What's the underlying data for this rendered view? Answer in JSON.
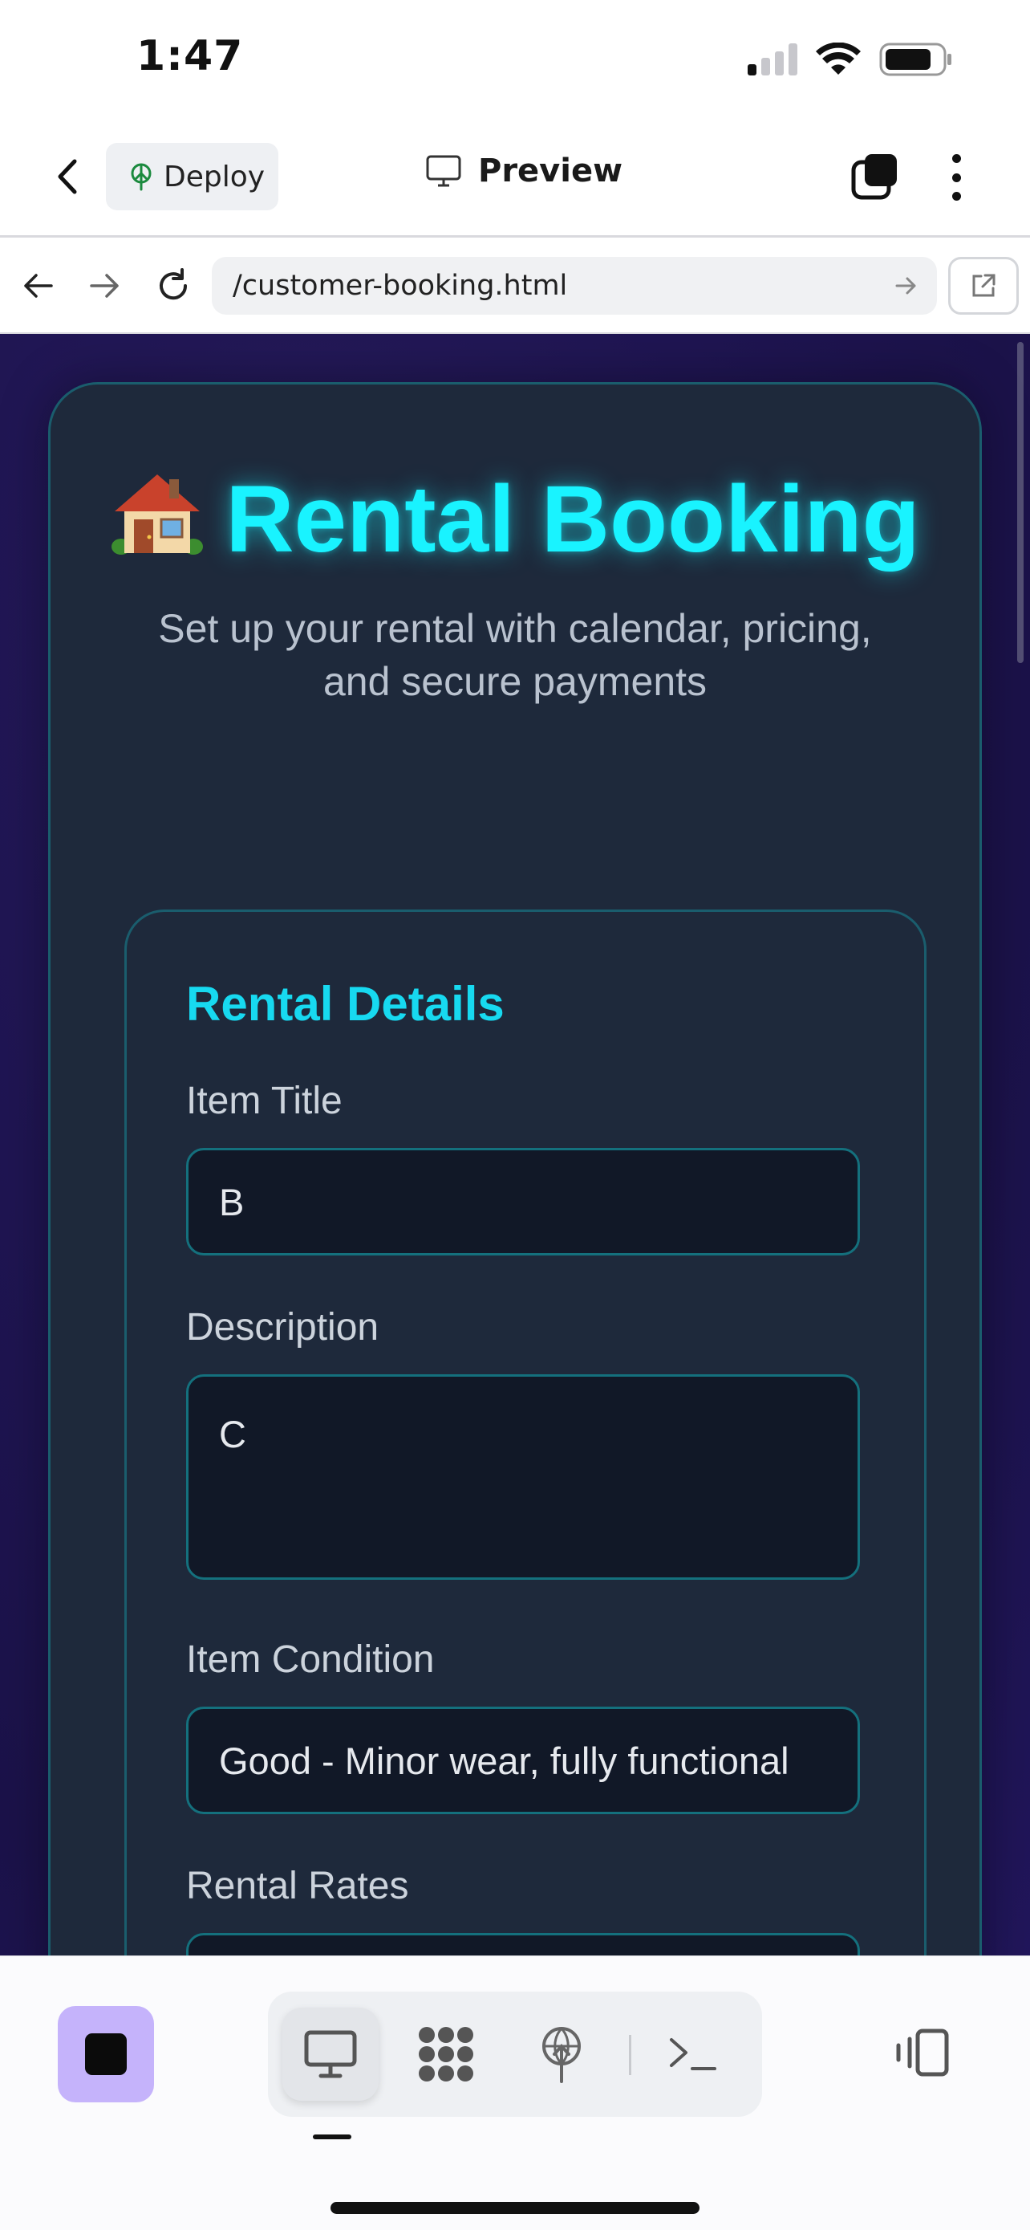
{
  "status_bar": {
    "time": "1:47"
  },
  "app_toolbar": {
    "deploy_label": "Deploy",
    "preview_label": "Preview"
  },
  "browser": {
    "url": "/customer-booking.html"
  },
  "page": {
    "hero_title": "Rental Booking",
    "hero_subtitle": "Set up your rental with calendar, pricing, and secure payments",
    "section_title": "Rental Details",
    "fields": {
      "item_title": {
        "label": "Item Title",
        "value": "B"
      },
      "description": {
        "label": "Description",
        "value": "C"
      },
      "item_condition": {
        "label": "Item Condition",
        "value": "Good - Minor wear, fully functional"
      },
      "rental_rates": {
        "label": "Rental Rates"
      }
    }
  },
  "colors": {
    "accent_cyan": "#19f3ff",
    "card_bg": "#1e293b",
    "input_bg": "#111827",
    "page_bg": "#1f1552",
    "stop_button": "#c5b3fb"
  },
  "icons": [
    "back-chevron-icon",
    "deploy-icon",
    "monitor-icon",
    "tabs-icon",
    "more-vertical-icon",
    "arrow-left-icon",
    "arrow-right-icon",
    "reload-icon",
    "go-arrow-icon",
    "external-link-icon",
    "house-emoji-icon",
    "stop-icon",
    "desktop-icon",
    "graph-icon",
    "deploy-antenna-icon",
    "terminal-icon",
    "devices-icon"
  ]
}
